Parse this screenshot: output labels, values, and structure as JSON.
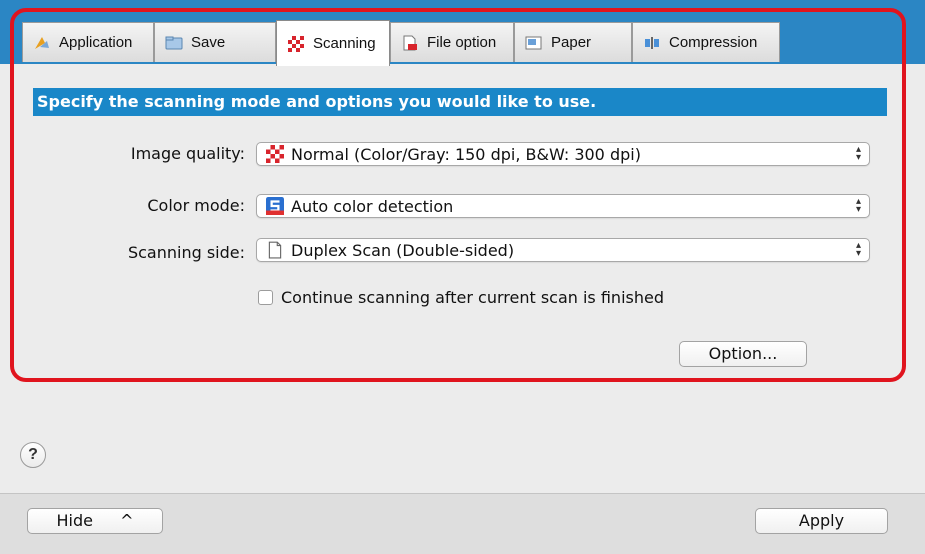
{
  "tabs": [
    {
      "label": "Application",
      "icon": "application-icon"
    },
    {
      "label": "Save",
      "icon": "folder-icon"
    },
    {
      "label": "Scanning",
      "icon": "scanning-icon",
      "active": true
    },
    {
      "label": "File option",
      "icon": "file-option-icon"
    },
    {
      "label": "Paper",
      "icon": "paper-icon"
    },
    {
      "label": "Compression",
      "icon": "compression-icon"
    }
  ],
  "scanning": {
    "heading": "Specify the scanning mode and options you would like to use.",
    "image_quality": {
      "label": "Image quality:",
      "value": "Normal (Color/Gray: 150 dpi, B&W: 300 dpi)",
      "icon": "checkerboard-icon"
    },
    "color_mode": {
      "label": "Color mode:",
      "value": "Auto color detection",
      "icon": "auto-color-icon"
    },
    "scanning_side": {
      "label": "Scanning side:",
      "value": "Duplex Scan (Double-sided)",
      "icon": "document-icon"
    },
    "continue_scanning": {
      "label": "Continue scanning after current scan is finished",
      "checked": false
    },
    "option_button": "Option..."
  },
  "footer": {
    "help": "?",
    "hide_button": "Hide",
    "hide_arrow": "^",
    "apply_button": "Apply"
  },
  "colors": {
    "tab_bar": "#2b86c4",
    "heading_bg": "#1a87c8",
    "highlight_border": "#e0141e"
  }
}
